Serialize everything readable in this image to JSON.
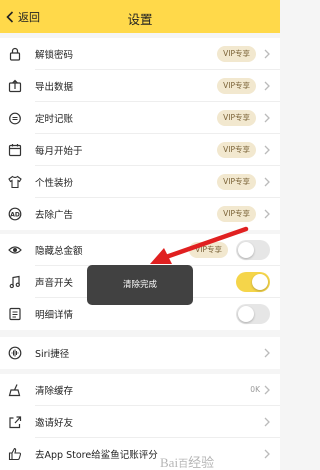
{
  "header": {
    "back_label": "返回",
    "title": "设置"
  },
  "group1": [
    {
      "icon": "lock-icon",
      "label": "解锁密码",
      "badge": "VIP专享"
    },
    {
      "icon": "export-icon",
      "label": "导出数据",
      "badge": "VIP专享"
    },
    {
      "icon": "timer-icon",
      "label": "定时记账",
      "badge": "VIP专享"
    },
    {
      "icon": "calendar-icon",
      "label": "每月开始于",
      "badge": "VIP专享"
    },
    {
      "icon": "shirt-icon",
      "label": "个性装扮",
      "badge": "VIP专享"
    },
    {
      "icon": "ad-block-icon",
      "label": "去除广告",
      "badge": "VIP专享"
    }
  ],
  "group2": [
    {
      "icon": "eye-icon",
      "label": "隐藏总金额",
      "badge": "VIP专享",
      "toggle": false
    },
    {
      "icon": "music-note-icon",
      "label": "声音开关",
      "toggle": true
    },
    {
      "icon": "document-icon",
      "label": "明细详情",
      "toggle": false
    }
  ],
  "group3": [
    {
      "icon": "siri-icon",
      "label": "Siri捷径"
    }
  ],
  "group4": [
    {
      "icon": "broom-icon",
      "label": "清除缓存",
      "value": "0K"
    },
    {
      "icon": "share-icon",
      "label": "邀请好友"
    },
    {
      "icon": "thumb-up-icon",
      "label": "去App Store给鲨鱼记账评分"
    }
  ],
  "toast": {
    "text": "清除完成"
  },
  "colors": {
    "accent": "#ffd94a",
    "toggle_on": "#f5d54a",
    "annotation_arrow": "#e02020"
  }
}
